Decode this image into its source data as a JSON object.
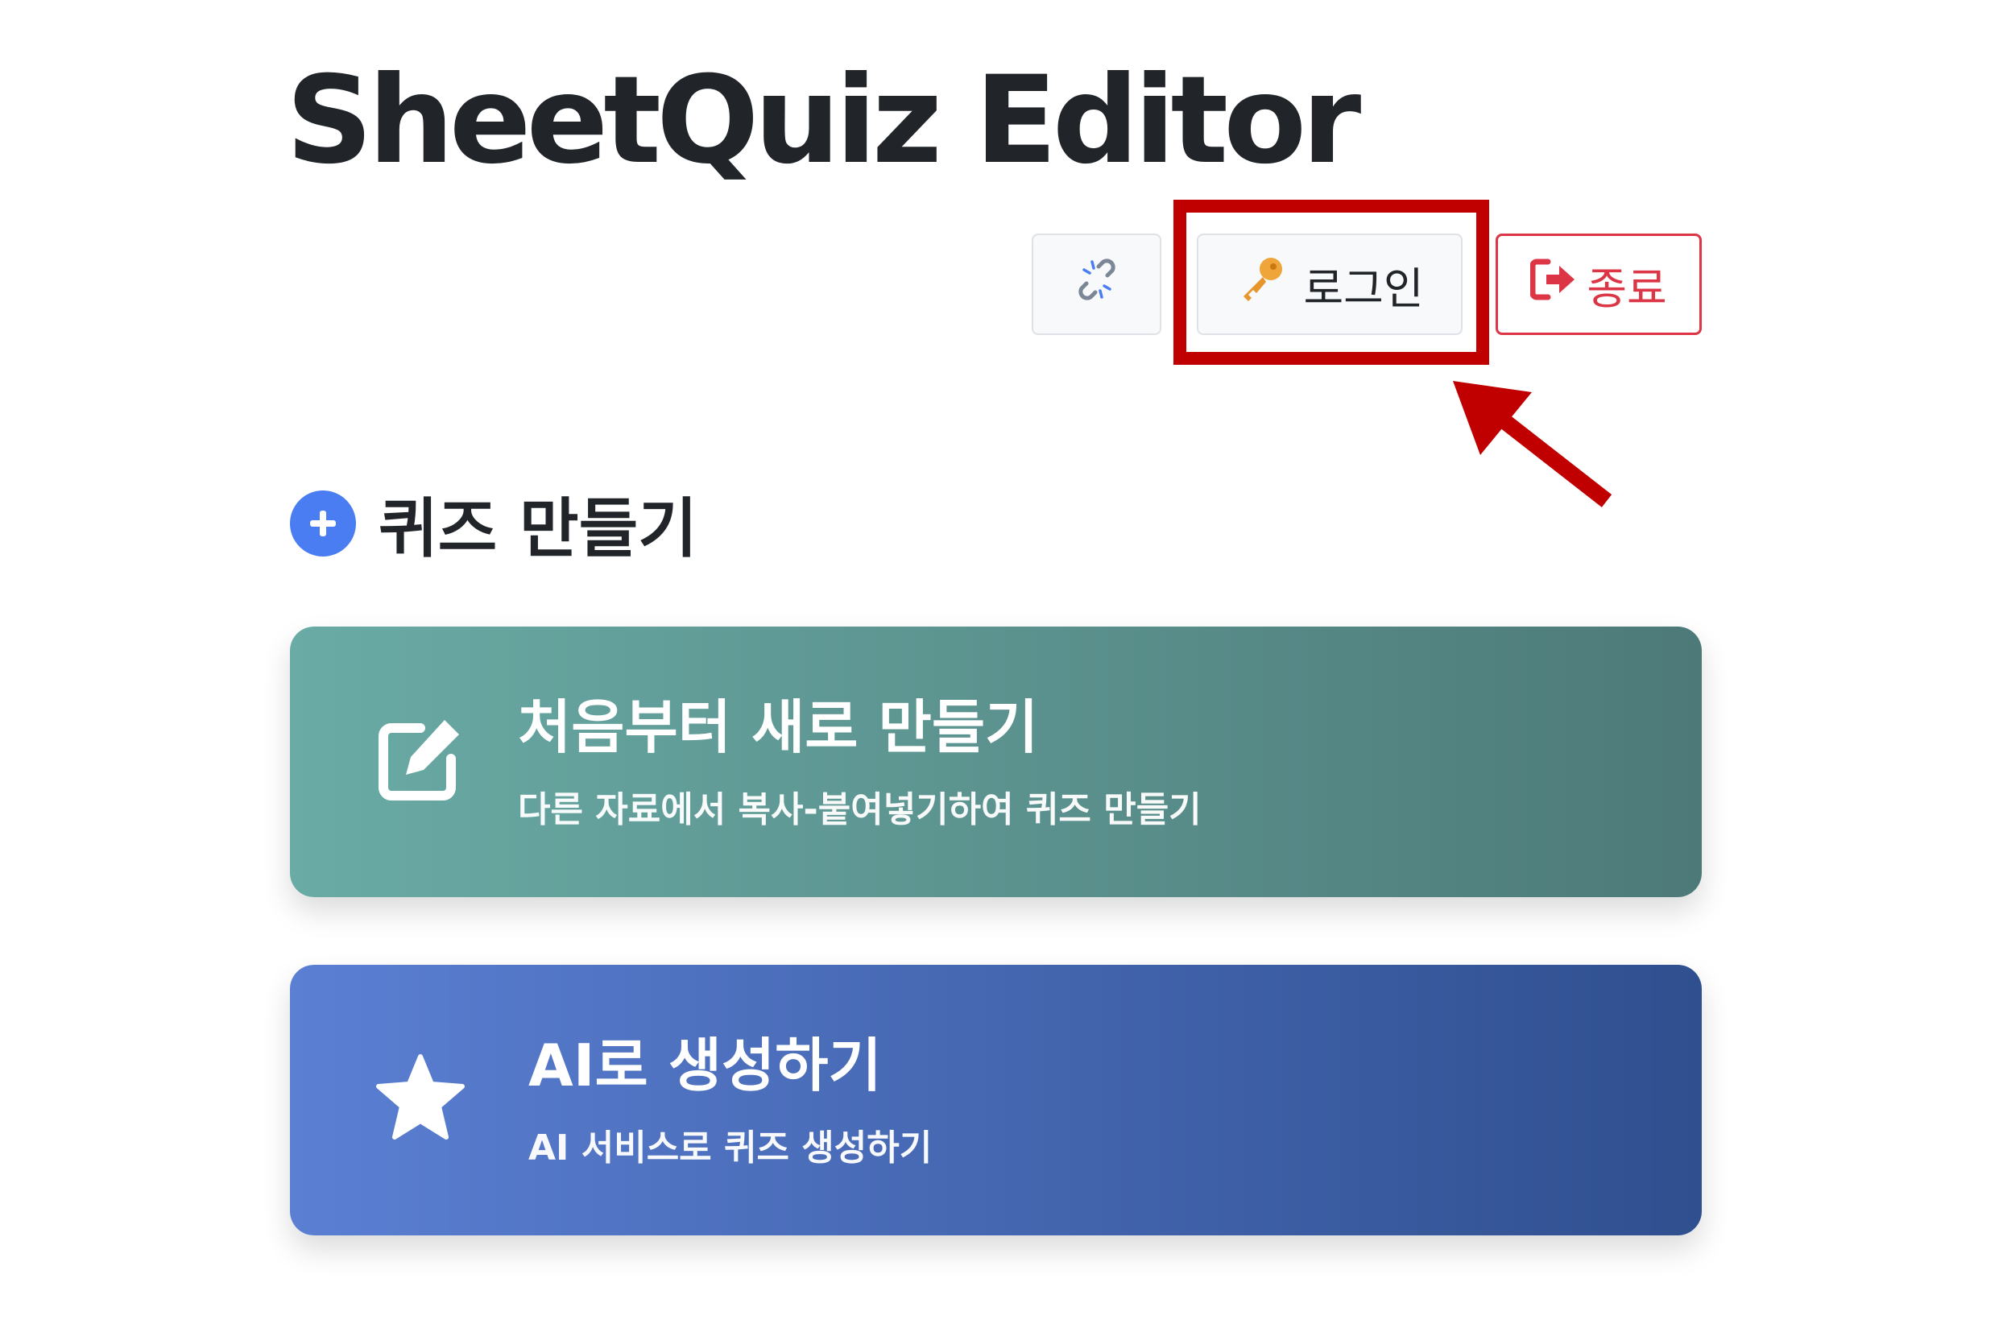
{
  "header": {
    "app_title": "SheetQuiz Editor"
  },
  "toolbar": {
    "link_icon": "broken-link-icon",
    "login_icon": "key-icon",
    "login_label": "로그인",
    "exit_icon": "sign-out-icon",
    "exit_label": "종료"
  },
  "annotation": {
    "highlight_color": "#c00000",
    "highlight_target": "login-button",
    "arrow_color": "#c00000"
  },
  "create_section": {
    "icon": "plus-circle-icon",
    "title": "퀴즈 만들기"
  },
  "cards": [
    {
      "icon": "edit-icon",
      "title": "처음부터 새로 만들기",
      "subtitle": "다른 자료에서 복사-붙여넣기하여 퀴즈 만들기",
      "color_start": "#6aaba5",
      "color_end": "#4d7a79"
    },
    {
      "icon": "star-icon",
      "title": "AI로 생성하기",
      "subtitle": "AI 서비스로 퀴즈 생성하기",
      "color_start": "#5b7fd3",
      "color_end": "#2f4f8f"
    }
  ],
  "colors": {
    "exit": "#dc3545",
    "accent_blue": "#4a7df2",
    "title_text": "#212529"
  }
}
